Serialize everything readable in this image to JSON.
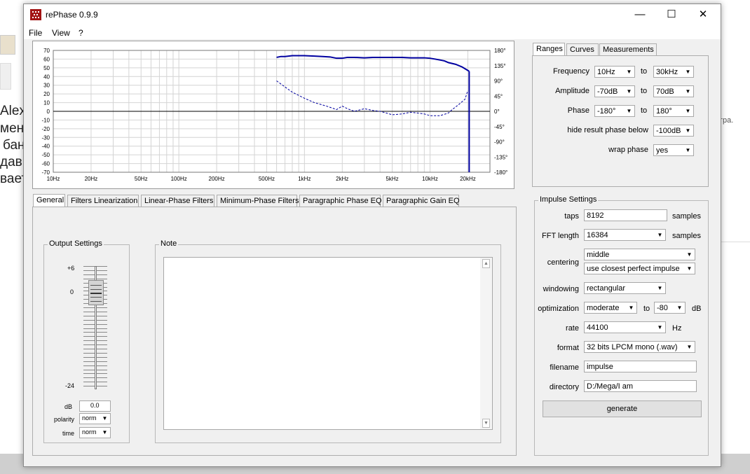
{
  "background": {
    "left_texts": [
      "Alex",
      "мени",
      "бан",
      "дав",
      "вает"
    ],
    "right_text": "гра."
  },
  "window": {
    "title": "rePhase 0.9.9",
    "minimize": "—",
    "maximize": "☐",
    "close": "✕"
  },
  "menu": {
    "file": "File",
    "view": "View",
    "help": "?"
  },
  "graph": {
    "y_left_ticks": [
      "70",
      "60",
      "50",
      "40",
      "30",
      "20",
      "10",
      "0",
      "-10",
      "-20",
      "-30",
      "-40",
      "-50",
      "-60",
      "-70"
    ],
    "y_right_ticks": [
      "180°",
      "135°",
      "90°",
      "45°",
      "0°",
      "-45°",
      "-90°",
      "-135°",
      "-180°"
    ],
    "x_ticks": [
      "10Hz",
      "20Hz",
      "50Hz",
      "100Hz",
      "200Hz",
      "500Hz",
      "1kHz",
      "2kHz",
      "5kHz",
      "10kHz",
      "20kHz"
    ],
    "colors": {
      "curve": "#0000a0",
      "grid": "#d4d4d4",
      "axis": "#000000"
    }
  },
  "right_tabs": {
    "ranges": "Ranges",
    "curves": "Curves",
    "measurements": "Measurements"
  },
  "ranges": {
    "frequency_label": "Frequency",
    "frequency_from": "10Hz",
    "frequency_to": "30kHz",
    "amplitude_label": "Amplitude",
    "amplitude_from": "-70dB",
    "amplitude_to": "70dB",
    "phase_label": "Phase",
    "phase_from": "-180°",
    "phase_to": "180°",
    "to": "to",
    "hide_phase_label": "hide result phase below",
    "hide_phase_value": "-100dB",
    "wrap_phase_label": "wrap phase",
    "wrap_phase_value": "yes"
  },
  "bottom_tabs": [
    "General",
    "Filters Linearization",
    "Linear-Phase Filters",
    "Minimum-Phase Filters",
    "Paragraphic Phase EQ",
    "Paragraphic Gain EQ"
  ],
  "output": {
    "title": "Output Settings",
    "scale_top": "+6",
    "scale_zero": "0",
    "scale_bottom": "-24",
    "db_label": "dB",
    "db_value": "0.0",
    "polarity_label": "polarity",
    "polarity_value": "norm",
    "time_label": "time",
    "time_value": "norm"
  },
  "note": {
    "title": "Note"
  },
  "impulse": {
    "title": "Impulse Settings",
    "taps_label": "taps",
    "taps_value": "8192",
    "samples": "samples",
    "fft_label": "FFT length",
    "fft_value": "16384",
    "centering_label": "centering",
    "centering_value": "middle",
    "centering_mode": "use closest perfect impulse",
    "windowing_label": "windowing",
    "windowing_value": "rectangular",
    "optimization_label": "optimization",
    "optimization_value": "moderate",
    "optimization_to": "to",
    "optimization_db_value": "-80",
    "db": "dB",
    "rate_label": "rate",
    "rate_value": "44100",
    "hz": "Hz",
    "format_label": "format",
    "format_value": "32 bits LPCM mono (.wav)",
    "filename_label": "filename",
    "filename_value": "impulse",
    "directory_label": "directory",
    "directory_value": "D:/Mega/I am",
    "generate": "generate"
  }
}
